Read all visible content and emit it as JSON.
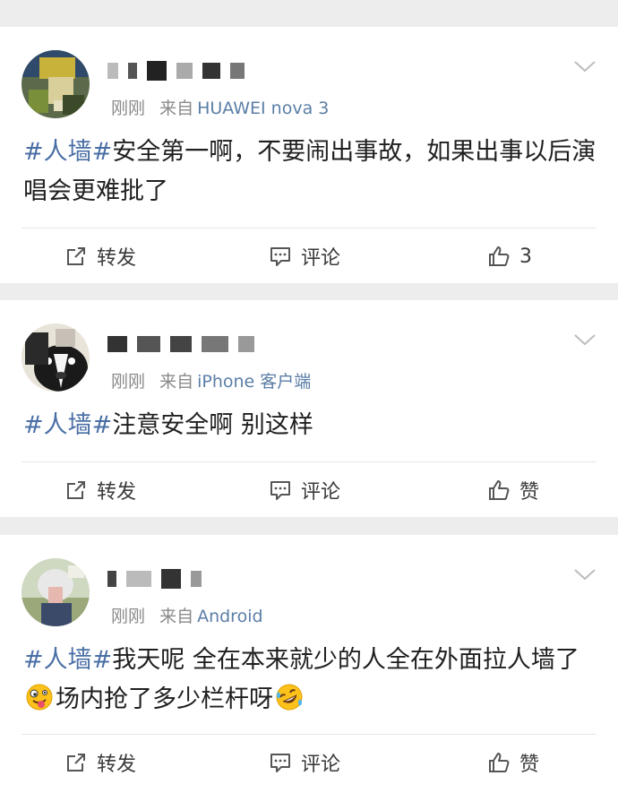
{
  "colors": {
    "background": "#ededed",
    "card": "#ffffff",
    "hashtag": "#4a6fa5",
    "device": "#5b7ea6",
    "meta": "#8a8a8a"
  },
  "posts": [
    {
      "time": "刚刚",
      "from_label": "来自",
      "device": "HUAWEI nova 3",
      "hashtag": "#人墙#",
      "text": "安全第一啊，不要闹出事故，如果出事以后演唱会更难批了",
      "repost_label": "转发",
      "comment_label": "评论",
      "like_label": "3"
    },
    {
      "time": "刚刚",
      "from_label": "来自",
      "device": "iPhone 客户端",
      "hashtag": "#人墙#",
      "text": "注意安全啊 别这样",
      "repost_label": "转发",
      "comment_label": "评论",
      "like_label": "赞"
    },
    {
      "time": "刚刚",
      "from_label": "来自",
      "device": "Android",
      "hashtag": "#人墙#",
      "text_part1": "我天呢 全在本来就少的人全在外面拉人墙了",
      "text_part2": "场内抢了多少栏杆呀",
      "repost_label": "转发",
      "comment_label": "评论",
      "like_label": "赞"
    }
  ]
}
